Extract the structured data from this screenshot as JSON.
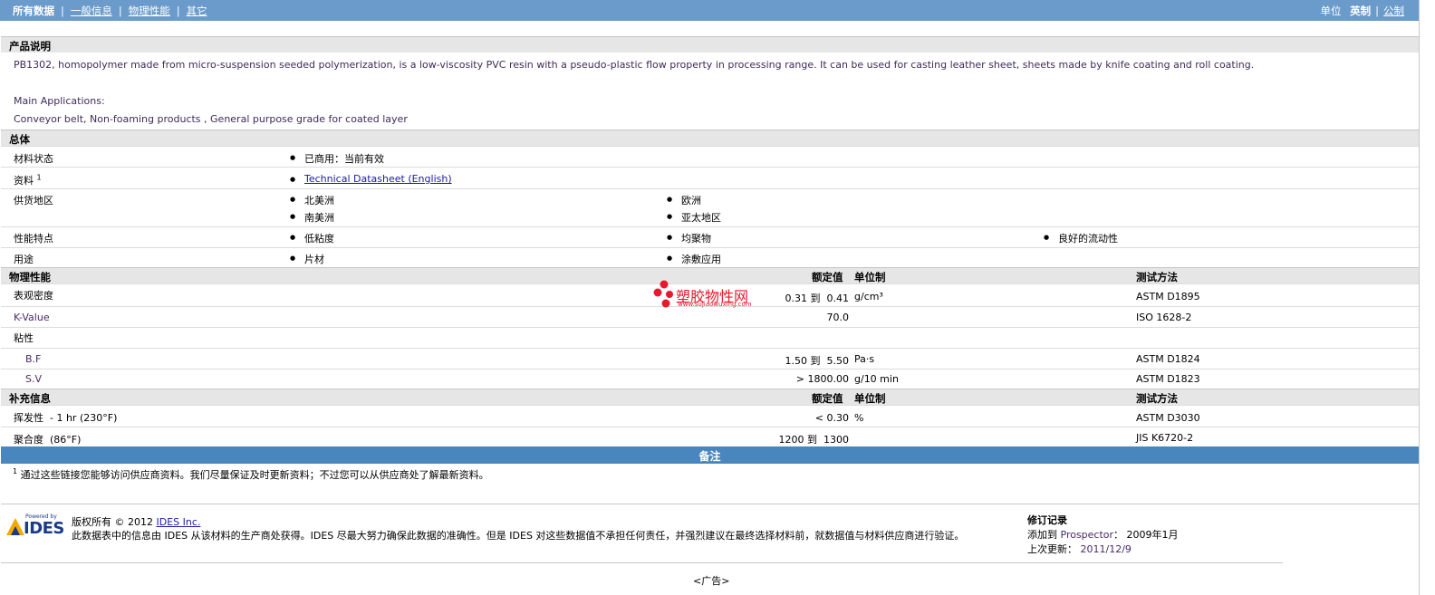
{
  "topbar": {
    "nav": [
      "所有数据",
      "一般信息",
      "物理性能",
      "其它"
    ],
    "units_label": "单位",
    "unit_options": [
      "英制",
      "公制"
    ]
  },
  "product": {
    "heading": "产品说明",
    "description": "PB1302, homopolymer made from micro-suspension seeded polymerization, is a low-viscosity PVC resin with a pseudo-plastic flow property in processing range. It can be used for casting leather sheet, sheets made by knife coating and roll coating.",
    "apps_label": "Main Applications:",
    "apps": "Conveyor belt, Non-foaming products , General purpose grade for coated layer"
  },
  "general": {
    "heading": "总体",
    "status_label": "材料状态",
    "status_value": "已商用：当前有效",
    "doc_label": "资料",
    "doc_sup": "1",
    "doc_link": "Technical Datasheet (English)",
    "regions_label": "供货地区",
    "regions": [
      "北美洲",
      "欧洲",
      "南美洲",
      "亚太地区"
    ],
    "features_label": "性能特点",
    "features": [
      "低粘度",
      "均聚物",
      "良好的流动性"
    ],
    "uses_label": "用途",
    "uses": [
      "片材",
      "涂敷应用"
    ]
  },
  "physical": {
    "heading": "物理性能",
    "col_nominal": "额定值",
    "col_unit": "单位制",
    "col_method": "测试方法",
    "density": {
      "label": "表观密度",
      "low": "0.31",
      "to": "到",
      "high": "0.41",
      "unit": "g/cm³",
      "method": "ASTM D1895"
    },
    "kvalue": {
      "label": "K-Value",
      "value": "70.0",
      "method": "ISO 1628-2"
    },
    "viscosity_label": "粘性",
    "bf": {
      "label": "B.F",
      "low": "1.50",
      "to": "到",
      "high": "5.50",
      "unit": "Pa·s",
      "method": "ASTM D1824"
    },
    "sv": {
      "label": "S.V",
      "value": "> 1800.00",
      "unit": "g/10 min",
      "method": "ASTM D1823"
    }
  },
  "watermark": {
    "text": "塑胶物性网",
    "url": "www.sujiaowuxing.com"
  },
  "additional": {
    "heading": "补充信息",
    "col_nominal": "额定值",
    "col_unit": "单位制",
    "col_method": "测试方法",
    "volatile": {
      "label": "挥发性",
      "cond": "- 1 hr (230°F)",
      "value": "< 0.30",
      "unit": "%",
      "method": "ASTM D3030"
    },
    "poly": {
      "label": "聚合度",
      "cond": "(86°F)",
      "low": "1200",
      "to": "到",
      "high": "1300",
      "method": "JIS K6720-2"
    }
  },
  "notes": {
    "heading": "备注",
    "sup": "1",
    "text": "通过这些链接您能够访问供应商资料。我们尽量保证及时更新资料；不过您可以从供应商处了解最新资料。"
  },
  "footer": {
    "logo_top": "Powered by",
    "logo_main": "IDES",
    "copyright_prefix": "版权所有 © 2012",
    "copyright_link": "IDES Inc.",
    "disclaimer": "此数据表中的信息由 IDES 从该材料的生产商处获得。IDES 尽最大努力确保此数据的准确性。但是 IDES 对这些数据值不承担任何责任，并强烈建议在最终选择材料前，就数据值与材料供应商进行验证。",
    "revision_heading": "修订记录",
    "added_label": "添加到",
    "added_link": "Prospector",
    "added_date": "： 2009年1月",
    "updated_label": "上次更新：",
    "updated_date": "2011/12/9",
    "ad": "<广告>"
  },
  "colors": {
    "header_bar": "#6b9bcb",
    "notes_bar": "#4a86be",
    "section_bg": "#e6e6e6",
    "watermark": "#e8192c"
  }
}
